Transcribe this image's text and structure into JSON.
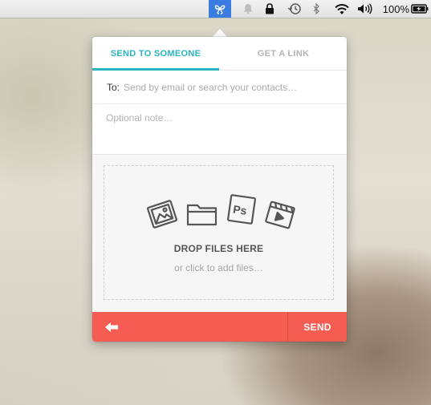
{
  "menubar": {
    "icons": [
      "app-icon",
      "bell-icon",
      "lock-icon",
      "time-machine-icon",
      "bluetooth-icon",
      "wifi-icon",
      "volume-icon",
      "battery-icon"
    ],
    "battery_text": "100%",
    "active_color": "#3a7ce0"
  },
  "popover": {
    "tabs": [
      {
        "label": "SEND TO SOMEONE",
        "active": true
      },
      {
        "label": "GET A LINK",
        "active": false
      }
    ],
    "to": {
      "label": "To:",
      "placeholder": "Send by email or search your contacts…",
      "value": ""
    },
    "note": {
      "placeholder": "Optional note…",
      "value": ""
    },
    "drop": {
      "icons": [
        "image-icon",
        "folder-icon",
        "photoshop-icon",
        "video-icon"
      ],
      "title": "DROP FILES HERE",
      "subtitle": "or click to add files…"
    },
    "footer": {
      "back_icon": "arrow-left-icon",
      "send_label": "SEND",
      "color": "#f55d52"
    },
    "accent_color": "#2bb3c0"
  }
}
